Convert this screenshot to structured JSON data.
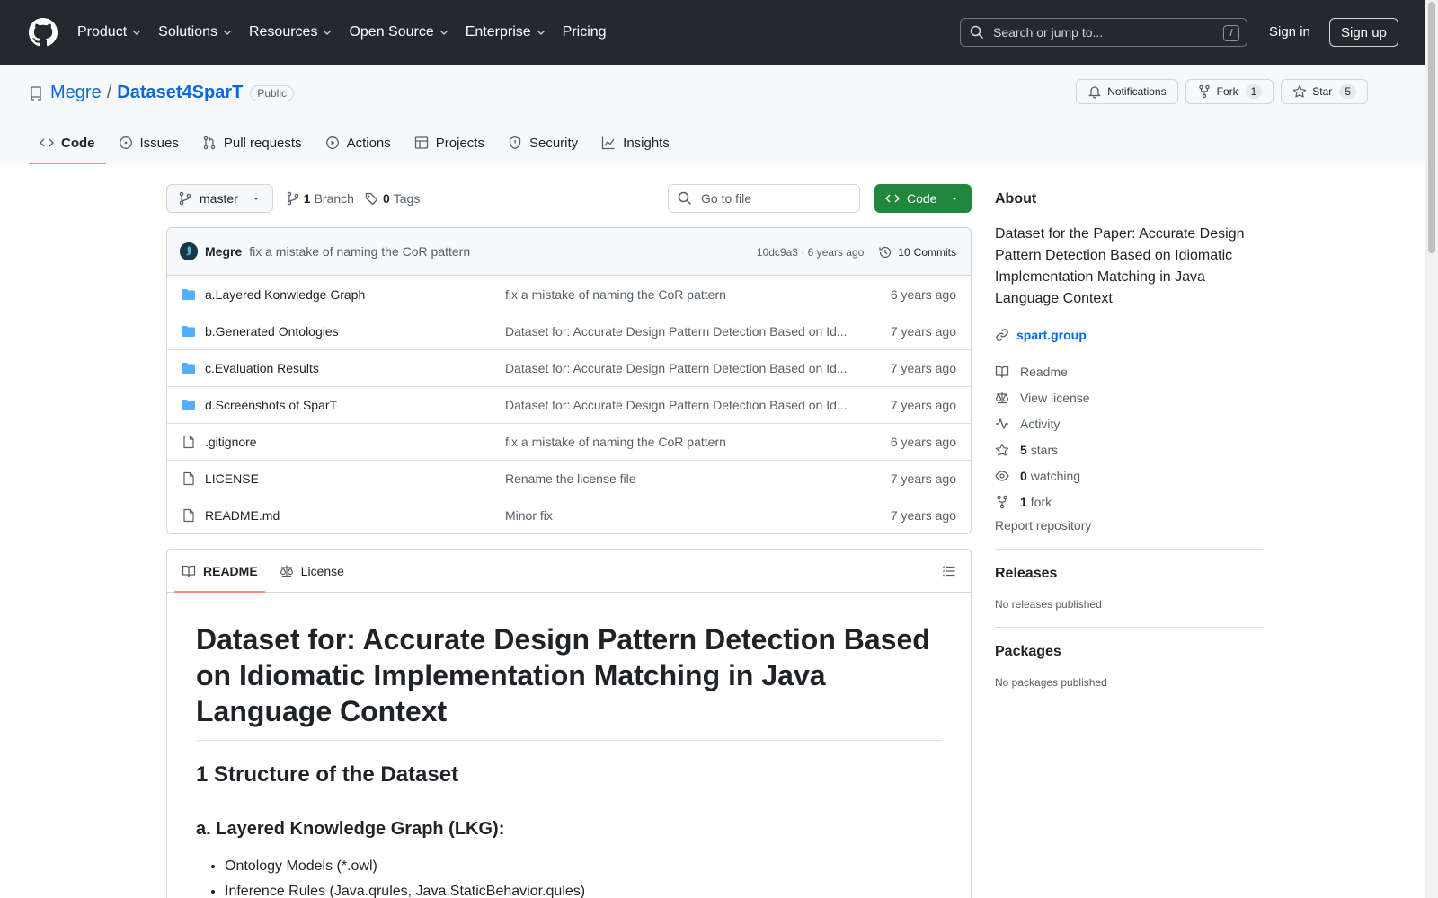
{
  "header": {
    "nav": [
      {
        "label": "Product",
        "has_menu": true
      },
      {
        "label": "Solutions",
        "has_menu": true
      },
      {
        "label": "Resources",
        "has_menu": true
      },
      {
        "label": "Open Source",
        "has_menu": true
      },
      {
        "label": "Enterprise",
        "has_menu": true
      },
      {
        "label": "Pricing",
        "has_menu": false
      }
    ],
    "search_placeholder": "Search or jump to...",
    "search_shortcut": "/",
    "sign_in": "Sign in",
    "sign_up": "Sign up"
  },
  "repo": {
    "owner": "Megre",
    "separator": "/",
    "name": "Dataset4SparT",
    "visibility": "Public",
    "notifications_label": "Notifications",
    "fork_label": "Fork",
    "fork_count": "1",
    "star_label": "Star",
    "star_count": "5"
  },
  "tabs": [
    {
      "label": "Code",
      "icon": "code-icon",
      "active": true
    },
    {
      "label": "Issues",
      "icon": "issue-icon",
      "active": false
    },
    {
      "label": "Pull requests",
      "icon": "pull-request-icon",
      "active": false
    },
    {
      "label": "Actions",
      "icon": "play-icon",
      "active": false
    },
    {
      "label": "Projects",
      "icon": "table-icon",
      "active": false
    },
    {
      "label": "Security",
      "icon": "shield-icon",
      "active": false
    },
    {
      "label": "Insights",
      "icon": "graph-icon",
      "active": false
    }
  ],
  "toolbar": {
    "branch": "master",
    "branch_count": "1",
    "branch_label": "Branch",
    "tag_count": "0",
    "tag_label": "Tags",
    "goto_placeholder": "Go to file",
    "code_button": "Code"
  },
  "latest_commit": {
    "author": "Megre",
    "message": "fix a mistake of naming the CoR pattern",
    "hash_age": "10dc9a3 · 6 years ago",
    "commits_count": "10",
    "commits_label": "Commits"
  },
  "files": [
    {
      "type": "folder",
      "name": "a.Layered Konwledge Graph",
      "message": "fix a mistake of naming the CoR pattern",
      "age": "6 years ago"
    },
    {
      "type": "folder",
      "name": "b.Generated Ontologies",
      "message": "Dataset for: Accurate Design Pattern Detection Based on Id...",
      "age": "7 years ago"
    },
    {
      "type": "folder",
      "name": "c.Evaluation Results",
      "message": "Dataset for: Accurate Design Pattern Detection Based on Id...",
      "age": "7 years ago"
    },
    {
      "type": "folder",
      "name": "d.Screenshots of SparT",
      "message": "Dataset for: Accurate Design Pattern Detection Based on Id...",
      "age": "7 years ago"
    },
    {
      "type": "file",
      "name": ".gitignore",
      "message": "fix a mistake of naming the CoR pattern",
      "age": "6 years ago"
    },
    {
      "type": "file",
      "name": "LICENSE",
      "message": "Rename the license file",
      "age": "7 years ago"
    },
    {
      "type": "file",
      "name": "README.md",
      "message": "Minor fix",
      "age": "7 years ago"
    }
  ],
  "readme": {
    "tab_readme": "README",
    "tab_license": "License",
    "h1": "Dataset for: Accurate Design Pattern Detection Based on Idiomatic Implementation Matching in Java Language Context",
    "h2": "1 Structure of the Dataset",
    "h3": "a. Layered Knowledge Graph (LKG):",
    "items": [
      "Ontology Models (*.owl)",
      "Inference Rules (Java.qrules, Java.StaticBehavior.qules)"
    ]
  },
  "about": {
    "heading": "About",
    "description": "Dataset for the Paper: Accurate Design Pattern Detection Based on Idiomatic Implementation Matching in Java Language Context",
    "website": "spart.group",
    "readme": "Readme",
    "license": "View license",
    "activity": "Activity",
    "stars_count": "5",
    "stars_label": "stars",
    "watching_count": "0",
    "watching_label": "watching",
    "forks_count": "1",
    "forks_label": "fork",
    "report": "Report repository"
  },
  "releases": {
    "heading": "Releases",
    "text": "No releases published"
  },
  "packages": {
    "heading": "Packages",
    "text": "No packages published"
  },
  "colors": {
    "header_bg": "#24292f",
    "link": "#0969da",
    "green_button": "#1f883d",
    "active_tab_underline": "#fd8c73",
    "folder": "#54aeff"
  }
}
